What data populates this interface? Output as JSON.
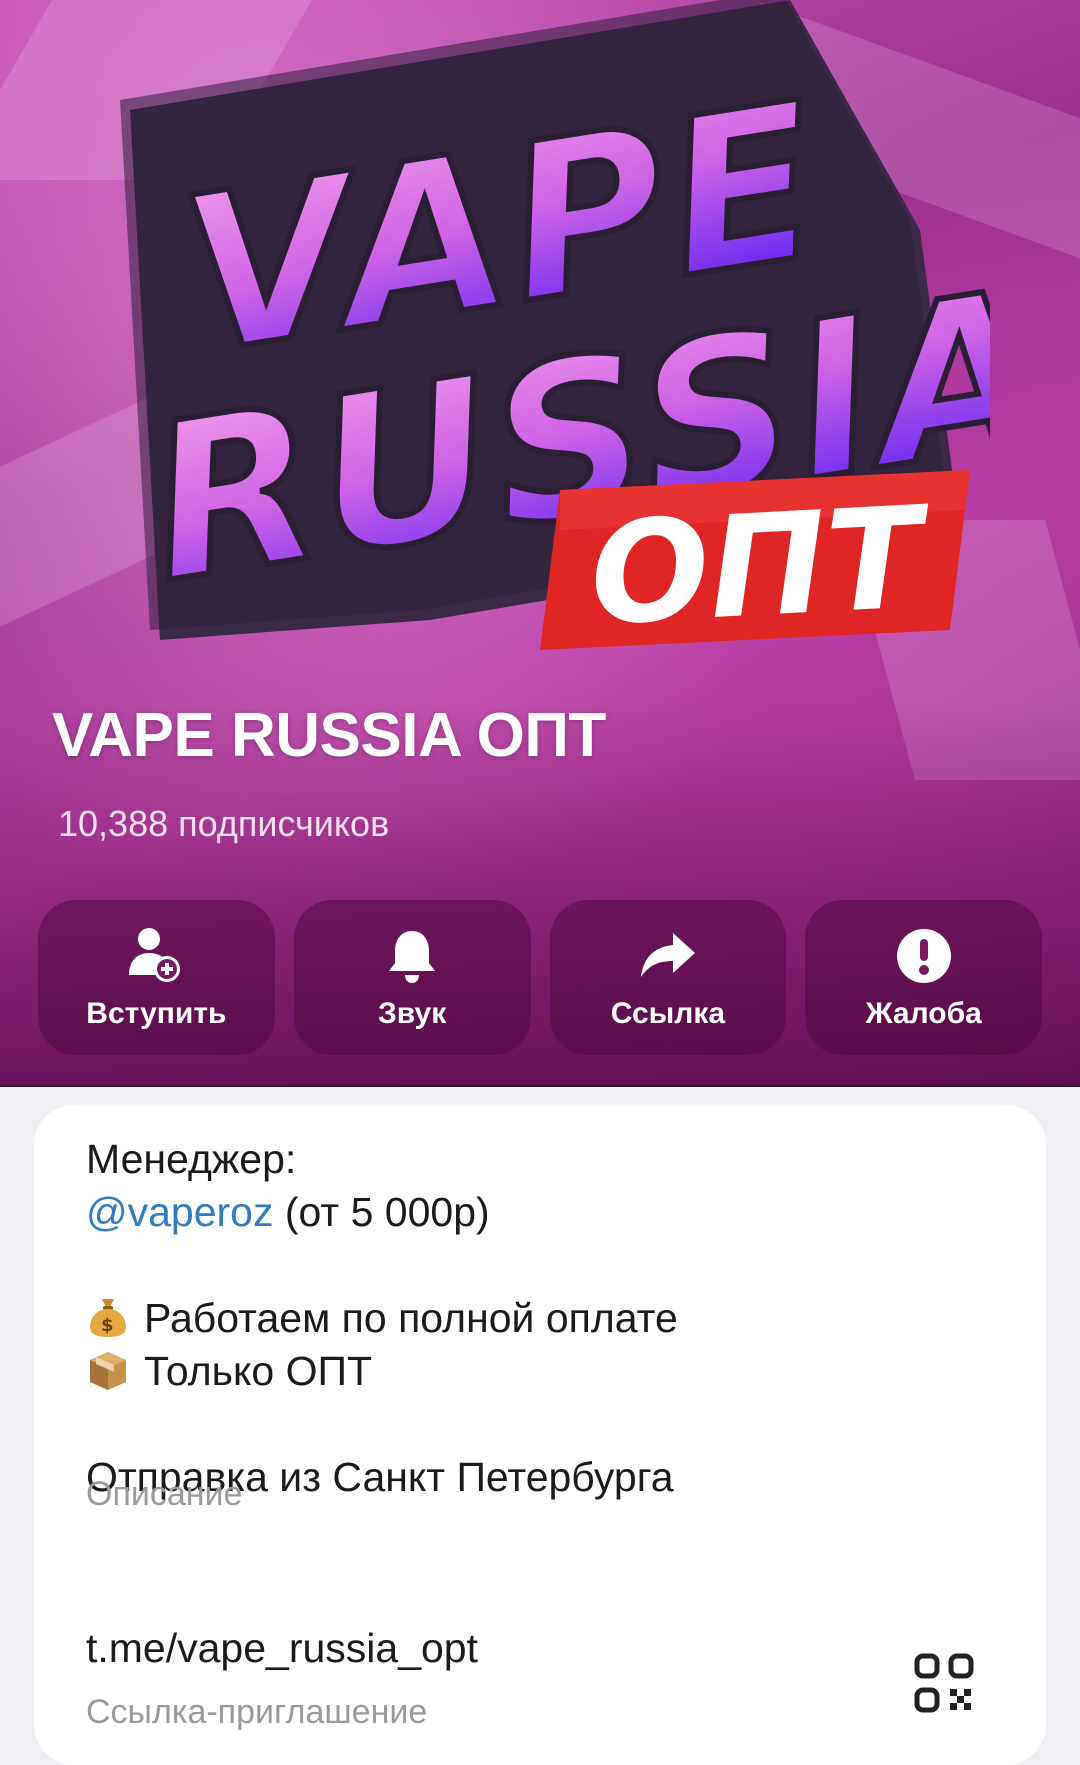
{
  "channel": {
    "logo_text": [
      "VAPE",
      "RUSSIA",
      "ОПТ"
    ],
    "name": "VAPE RUSSIA ОПТ",
    "subscribers": "10,388 подписчиков"
  },
  "actions": [
    {
      "label": "Вступить",
      "icon": "add-user-icon"
    },
    {
      "label": "Звук",
      "icon": "bell-icon"
    },
    {
      "label": "Ссылка",
      "icon": "share-arrow-icon"
    },
    {
      "label": "Жалоба",
      "icon": "exclamation-icon"
    }
  ],
  "info": {
    "description": {
      "line1": "Менеджер:",
      "mention": "@vaperoz",
      "mention_suffix": " (от 5 000р)",
      "line3": "Работаем по полной оплате",
      "line3_emoji": "money-bag-icon",
      "line4": "Только ОПТ",
      "line4_emoji": "package-icon",
      "line5": "Отправка из Санкт Петербурга"
    },
    "description_caption": "Описание",
    "invite_link": "t.me/vape_russia_opt",
    "invite_caption": "Ссылка-приглашение"
  },
  "colors": {
    "accent_link": "#2f7dbf",
    "hero_pink": "#c64fb6",
    "logo_red": "#e02525"
  }
}
